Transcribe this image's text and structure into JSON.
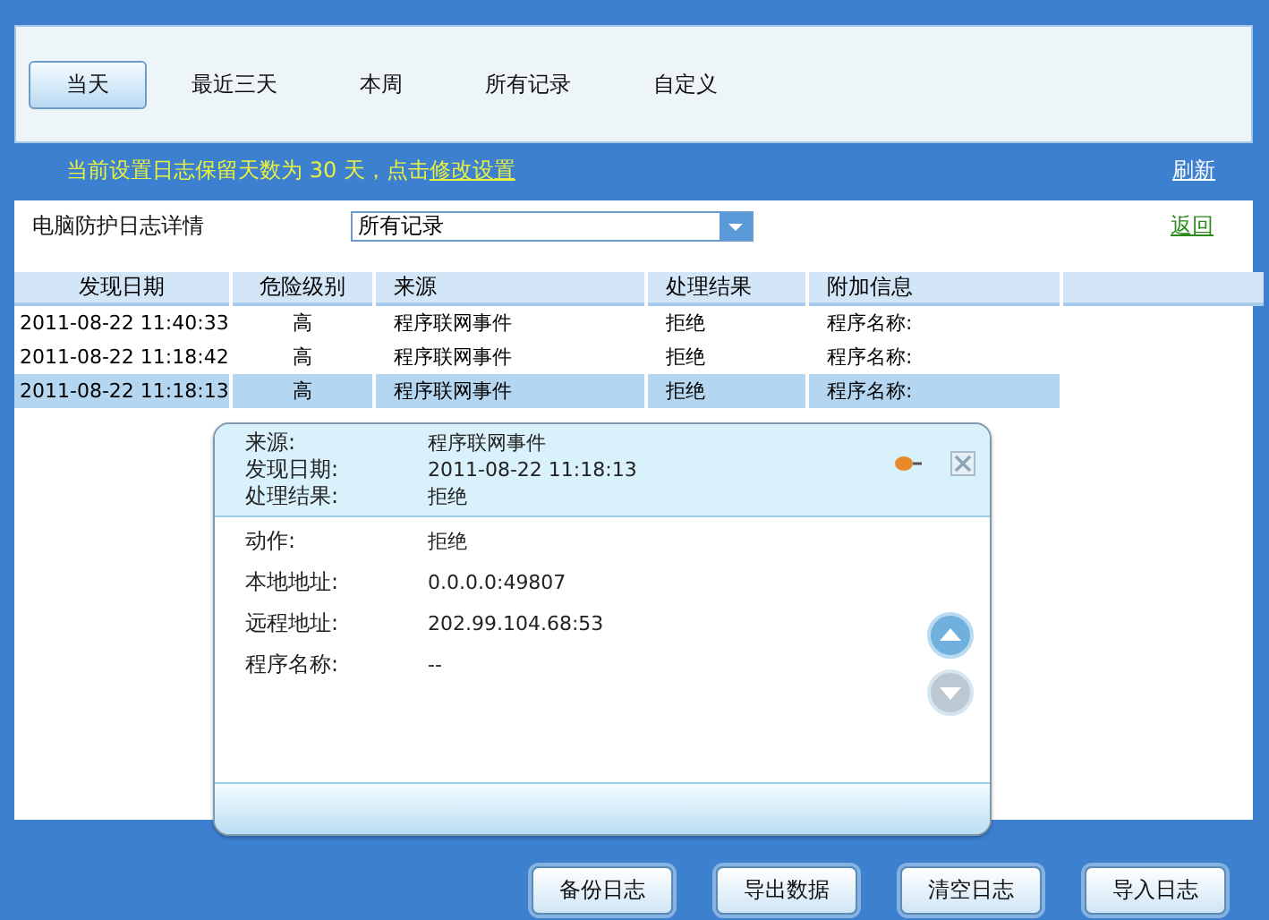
{
  "tabs": [
    {
      "label": "当天",
      "selected": true
    },
    {
      "label": "最近三天",
      "selected": false
    },
    {
      "label": "本周",
      "selected": false
    },
    {
      "label": "所有记录",
      "selected": false
    },
    {
      "label": "自定义",
      "selected": false
    }
  ],
  "notice": {
    "text": "当前设置日志保留天数为 30 天，点击",
    "link": "修改设置"
  },
  "refresh": "刷新",
  "filter": {
    "label": "电脑防护日志详情",
    "value": "所有记录"
  },
  "back": "返回",
  "table": {
    "columns": [
      "发现日期",
      "危险级别",
      "来源",
      "处理结果",
      "附加信息"
    ],
    "rows": [
      {
        "cells": [
          "2011-08-22 11:40:33",
          "高",
          "程序联网事件",
          "拒绝",
          "程序名称:"
        ],
        "selected": false
      },
      {
        "cells": [
          "2011-08-22 11:18:42",
          "高",
          "程序联网事件",
          "拒绝",
          "程序名称:"
        ],
        "selected": false
      },
      {
        "cells": [
          "2011-08-22 11:18:13",
          "高",
          "程序联网事件",
          "拒绝",
          "程序名称:"
        ],
        "selected": true
      }
    ]
  },
  "popup": {
    "header": [
      {
        "label": "来源:",
        "value": "程序联网事件"
      },
      {
        "label": "发现日期:",
        "value": "2011-08-22 11:18:13"
      },
      {
        "label": "处理结果:",
        "value": "拒绝"
      }
    ],
    "details": [
      {
        "label": "动作:",
        "value": "拒绝"
      },
      {
        "label": "本地地址:",
        "value": "0.0.0.0:49807"
      },
      {
        "label": "远程地址:",
        "value": "202.99.104.68:53"
      },
      {
        "label": "程序名称:",
        "value": "--"
      }
    ]
  },
  "buttons": [
    "备份日志",
    "导出数据",
    "清空日志",
    "导入日志"
  ]
}
